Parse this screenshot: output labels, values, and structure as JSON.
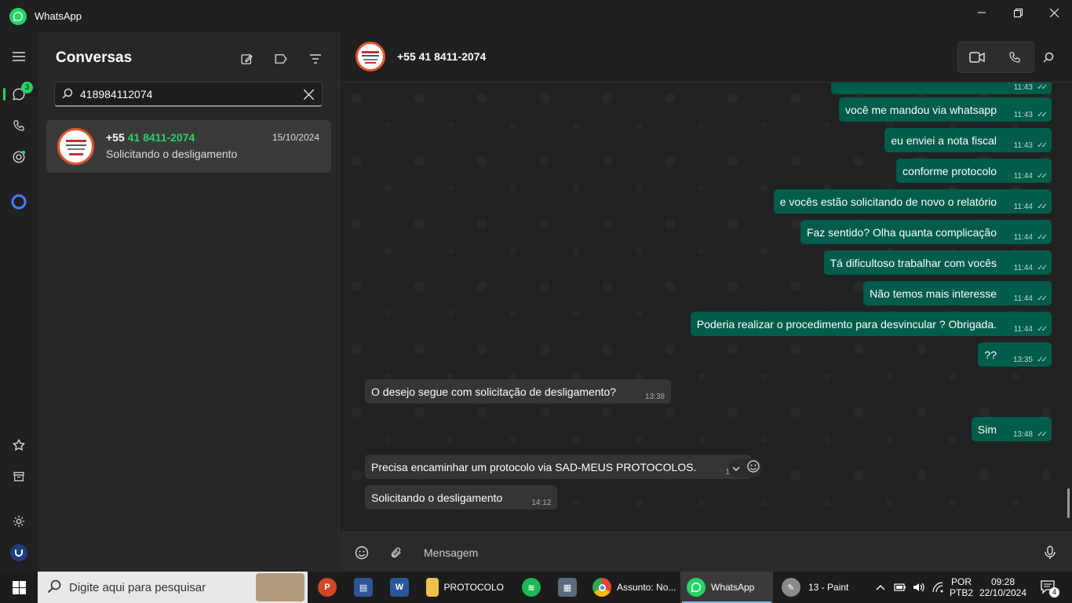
{
  "window": {
    "title": "WhatsApp"
  },
  "rail": {
    "chats_badge": "3"
  },
  "sidebar": {
    "title": "Conversas",
    "search_value": "418984112074",
    "conversation": {
      "name_prefix": "+55 ",
      "name_highlight": "41 8411-2074",
      "date": "15/10/2024",
      "preview": "Solicitando o desligamento"
    }
  },
  "chat": {
    "contact": "+55 41 8411-2074",
    "messages": [
      {
        "dir": "out",
        "text": "você me mandou via whatsapp",
        "time": "11:43"
      },
      {
        "dir": "out",
        "text": "eu enviei a nota fiscal",
        "time": "11:43"
      },
      {
        "dir": "out",
        "text": "conforme protocolo",
        "time": "11:44"
      },
      {
        "dir": "out",
        "text": "e vocês estão solicitando de novo o relatório",
        "time": "11:44"
      },
      {
        "dir": "out",
        "text": "Faz sentido? Olha quanta complicação",
        "time": "11:44"
      },
      {
        "dir": "out",
        "text": "Tá dificultoso trabalhar com vocês",
        "time": "11:44"
      },
      {
        "dir": "out",
        "text": "Não temos mais interesse",
        "time": "11:44"
      },
      {
        "dir": "out",
        "text": "Poderia realizar o procedimento para desvincular ? Obrigada.",
        "time": "11:44"
      },
      {
        "dir": "out",
        "text": "??",
        "time": "13:35"
      },
      {
        "dir": "in",
        "text": "O desejo segue com solicitação de desligamento?",
        "time": "13:38"
      },
      {
        "dir": "out",
        "text": "Sim",
        "time": "13:48"
      },
      {
        "dir": "in",
        "text": "Precisa encaminhar um protocolo via SAD-MEUS PROTOCOLOS.",
        "time": "14:12"
      },
      {
        "dir": "in",
        "text": "Solicitando o desligamento",
        "time": "14:12"
      }
    ],
    "partial_top_time": "11:43",
    "composer_placeholder": "Mensagem"
  },
  "taskbar": {
    "search_placeholder": "Digite aqui para pesquisar",
    "apps": {
      "protocolo": "PROTOCOLO",
      "chrome": "Assunto: No...",
      "whatsapp": "WhatsApp",
      "paint": "13 - Paint"
    },
    "lang_top": "POR",
    "lang_bottom": "PTB2",
    "time": "09:28",
    "date": "22/10/2024",
    "notifications": "4"
  }
}
